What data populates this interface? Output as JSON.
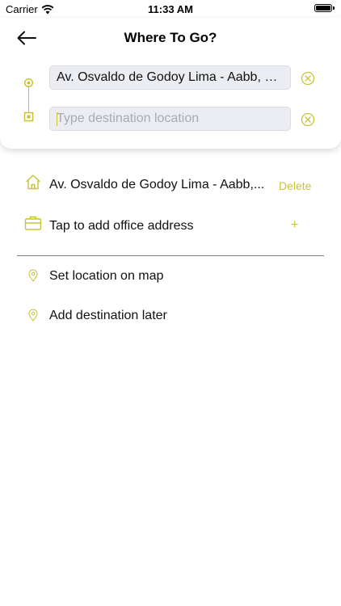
{
  "status_bar": {
    "carrier": "Carrier",
    "time": "11:33 AM",
    "battery_level": 1.0
  },
  "header": {
    "title": "Where To Go?"
  },
  "route": {
    "origin_value": "Av. Osvaldo de Godoy Lima - Aabb, S...",
    "destination_value": "",
    "destination_placeholder": "Type destination location"
  },
  "saved_places": {
    "home_label": "Av. Osvaldo de Godoy Lima - Aabb,...",
    "home_action": "Delete",
    "office_label": "Tap to add office address",
    "office_action": "+"
  },
  "options": {
    "set_on_map": "Set location on map",
    "add_later": "Add destination later"
  },
  "colors": {
    "accent": "#c9c236",
    "field_bg": "#ecedf2",
    "divider": "#7d7d7d"
  },
  "icons": [
    "wifi-icon",
    "battery-icon",
    "back-arrow-icon",
    "origin-dot-icon",
    "destination-square-icon",
    "clear-icon",
    "home-icon",
    "briefcase-icon",
    "location-pin-icon"
  ]
}
